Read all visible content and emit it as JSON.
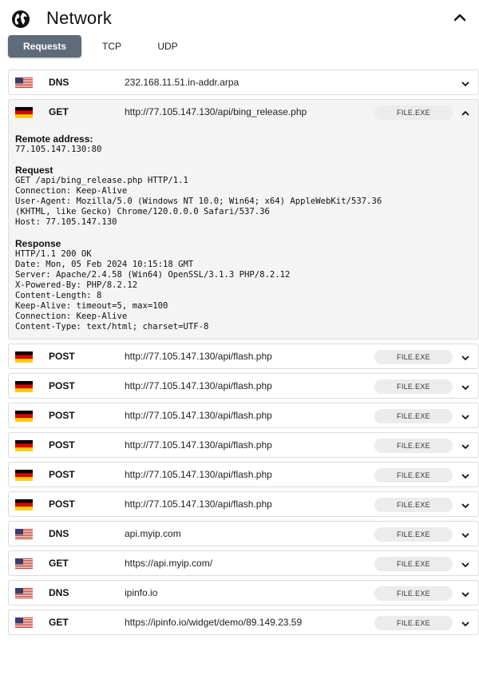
{
  "header": {
    "title": "Network",
    "icon": "globe-icon"
  },
  "tabs": [
    {
      "label": "Requests",
      "active": true
    },
    {
      "label": "TCP",
      "active": false
    },
    {
      "label": "UDP",
      "active": false
    }
  ],
  "requests": [
    {
      "flag": "us",
      "method": "DNS",
      "url": "232.168.11.51.in-addr.arpa",
      "badge": "",
      "expanded": false
    },
    {
      "flag": "de",
      "method": "GET",
      "url": "http://77.105.147.130/api/bing_release.php",
      "badge": "FILE.EXE",
      "expanded": true
    },
    {
      "flag": "de",
      "method": "POST",
      "url": "http://77.105.147.130/api/flash.php",
      "badge": "FILE.EXE",
      "expanded": false
    },
    {
      "flag": "de",
      "method": "POST",
      "url": "http://77.105.147.130/api/flash.php",
      "badge": "FILE.EXE",
      "expanded": false
    },
    {
      "flag": "de",
      "method": "POST",
      "url": "http://77.105.147.130/api/flash.php",
      "badge": "FILE.EXE",
      "expanded": false
    },
    {
      "flag": "de",
      "method": "POST",
      "url": "http://77.105.147.130/api/flash.php",
      "badge": "FILE.EXE",
      "expanded": false
    },
    {
      "flag": "de",
      "method": "POST",
      "url": "http://77.105.147.130/api/flash.php",
      "badge": "FILE.EXE",
      "expanded": false
    },
    {
      "flag": "de",
      "method": "POST",
      "url": "http://77.105.147.130/api/flash.php",
      "badge": "FILE.EXE",
      "expanded": false
    },
    {
      "flag": "us",
      "method": "DNS",
      "url": "api.myip.com",
      "badge": "FILE.EXE",
      "expanded": false
    },
    {
      "flag": "us",
      "method": "GET",
      "url": "https://api.myip.com/",
      "badge": "FILE.EXE",
      "expanded": false
    },
    {
      "flag": "us",
      "method": "DNS",
      "url": "ipinfo.io",
      "badge": "FILE.EXE",
      "expanded": false
    },
    {
      "flag": "us",
      "method": "GET",
      "url": "https://ipinfo.io/widget/demo/89.149.23.59",
      "badge": "FILE.EXE",
      "expanded": false
    }
  ],
  "detail": {
    "remote_label": "Remote address:",
    "remote_value": "77.105.147.130:80",
    "request_label": "Request",
    "request_lines": "GET /api/bing_release.php HTTP/1.1\nConnection: Keep-Alive\nUser-Agent: Mozilla/5.0 (Windows NT 10.0; Win64; x64) AppleWebKit/537.36\n(KHTML, like Gecko) Chrome/120.0.0.0 Safari/537.36\nHost: 77.105.147.130",
    "response_label": "Response",
    "response_lines": "HTTP/1.1 200 OK\nDate: Mon, 05 Feb 2024 10:15:18 GMT\nServer: Apache/2.4.58 (Win64) OpenSSL/3.1.3 PHP/8.2.12\nX-Powered-By: PHP/8.2.12\nContent-Length: 8\nKeep-Alive: timeout=5, max=100\nConnection: Keep-Alive\nContent-Type: text/html; charset=UTF-8"
  },
  "colors": {
    "tab_active_bg": "#5f6b7a",
    "row_border": "#dcdcdc",
    "expanded_bg": "#f4f4f4",
    "badge_bg": "#ececec"
  }
}
